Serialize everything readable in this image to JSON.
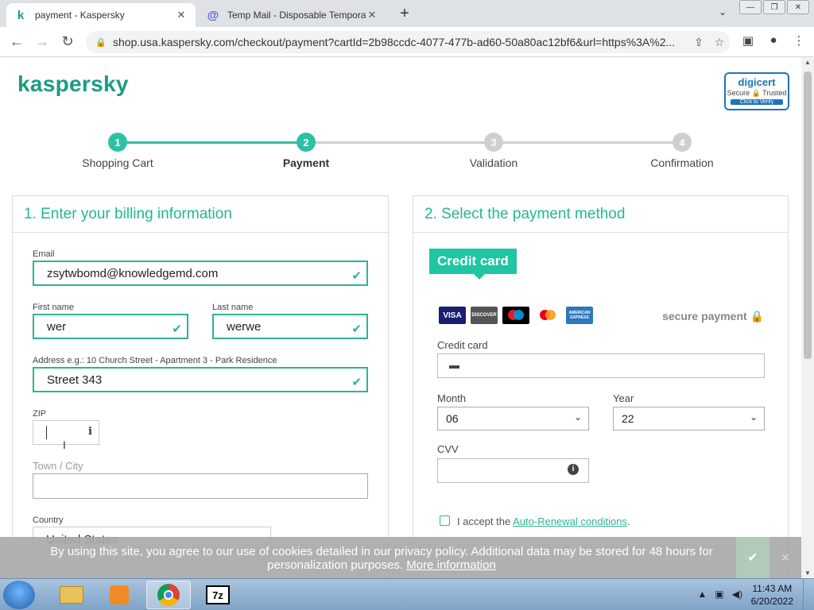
{
  "browser": {
    "tabs": [
      {
        "title": "payment - Kaspersky",
        "favicon": "k",
        "active": true
      },
      {
        "title": "Temp Mail - Disposable Tempora",
        "favicon": "@",
        "active": false
      }
    ],
    "url": "shop.usa.kaspersky.com/checkout/payment?cartId=2b98ccdc-4077-477b-ad60-50a80ac12bf6&url=https%3A%2..."
  },
  "header": {
    "logo_text": "kaspersky",
    "digicert": {
      "brand": "digicert",
      "line": "Secure 🔒 Trusted",
      "verify": "Click to Verify"
    }
  },
  "steps": [
    {
      "num": "1",
      "label": "Shopping Cart",
      "state": "done"
    },
    {
      "num": "2",
      "label": "Payment",
      "state": "current"
    },
    {
      "num": "3",
      "label": "Validation",
      "state": "todo"
    },
    {
      "num": "4",
      "label": "Confirmation",
      "state": "todo"
    }
  ],
  "billing": {
    "title": "1. Enter your billing information",
    "email_label": "Email",
    "email_value": "zsytwbomd@knowledgemd.com",
    "first_label": "First name",
    "first_value": "wer",
    "last_label": "Last name",
    "last_value": "werwe",
    "address_label": "Address e.g.: 10 Church Street - Apartment 3 - Park Residence",
    "address_value": "Street 343",
    "zip_label": "ZIP",
    "zip_value": "",
    "city_label": "Town / City",
    "city_value": "",
    "country_label": "Country",
    "country_value": "United States"
  },
  "payment": {
    "title": "2. Select the payment method",
    "method_badge": "Credit card",
    "card_brands": [
      "VISA",
      "DISCOVER",
      "maestro",
      "mastercard",
      "AMERICAN EXPRESS"
    ],
    "secure_text": "secure payment",
    "cc_label": "Credit card",
    "cc_value": "",
    "month_label": "Month",
    "month_value": "06",
    "year_label": "Year",
    "year_value": "22",
    "cvv_label": "CVV",
    "cvv_value": "",
    "accept_prefix": "I accept the",
    "accept_link": "Auto-Renewal conditions",
    "accept_suffix": "."
  },
  "cookie": {
    "message": "By using this site, you agree to our use of cookies detailed in our privacy policy. Additional data may be stored for 48 hours for personalization purposes.",
    "link": "More information"
  },
  "taskbar": {
    "time": "11:43 AM",
    "date": "6/20/2022",
    "apps": [
      "windows-explorer",
      "media-player",
      "chrome",
      "7-zip"
    ]
  },
  "colors": {
    "brand": "#1a9c82",
    "accent": "#21b797",
    "badge": "#20c5a3",
    "ok": "#2fb48e"
  }
}
